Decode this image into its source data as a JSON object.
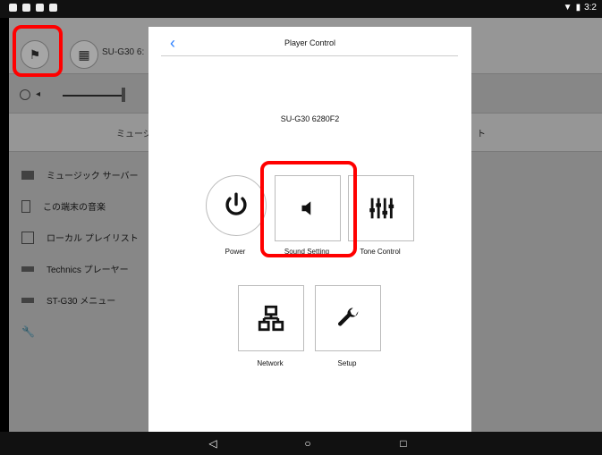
{
  "status_bar": {
    "time": "3:2"
  },
  "background_app": {
    "device_name": "SU-G30 6:",
    "tab_left": "ミュージ",
    "tab_right": "ト",
    "menu_items": [
      {
        "label": "ミュージック サーバー"
      },
      {
        "label": "この端末の音楽"
      },
      {
        "label": "ローカル プレイリスト"
      },
      {
        "label": "Technics プレーヤー"
      },
      {
        "label": "ST-G30 メニュー"
      },
      {
        "label": ""
      }
    ]
  },
  "modal": {
    "title": "Player Control",
    "device_name": "SU-G30 6280F2",
    "controls": [
      {
        "label": "Power"
      },
      {
        "label": "Sound Setting"
      },
      {
        "label": "Tone Control"
      },
      {
        "label": "Network"
      },
      {
        "label": "Setup"
      }
    ]
  },
  "icons": {
    "back": "chevron-left-icon",
    "power": "power-icon",
    "sound_setting": "speaker-icon",
    "tone_control": "equalizer-icon",
    "network": "network-icon",
    "setup": "wrench-icon",
    "nav_back": "back-triangle-icon",
    "nav_home": "home-circle-icon",
    "nav_recent": "recent-square-icon"
  },
  "colors": {
    "accent": "#2b7fff",
    "highlight": "#ff0000"
  }
}
